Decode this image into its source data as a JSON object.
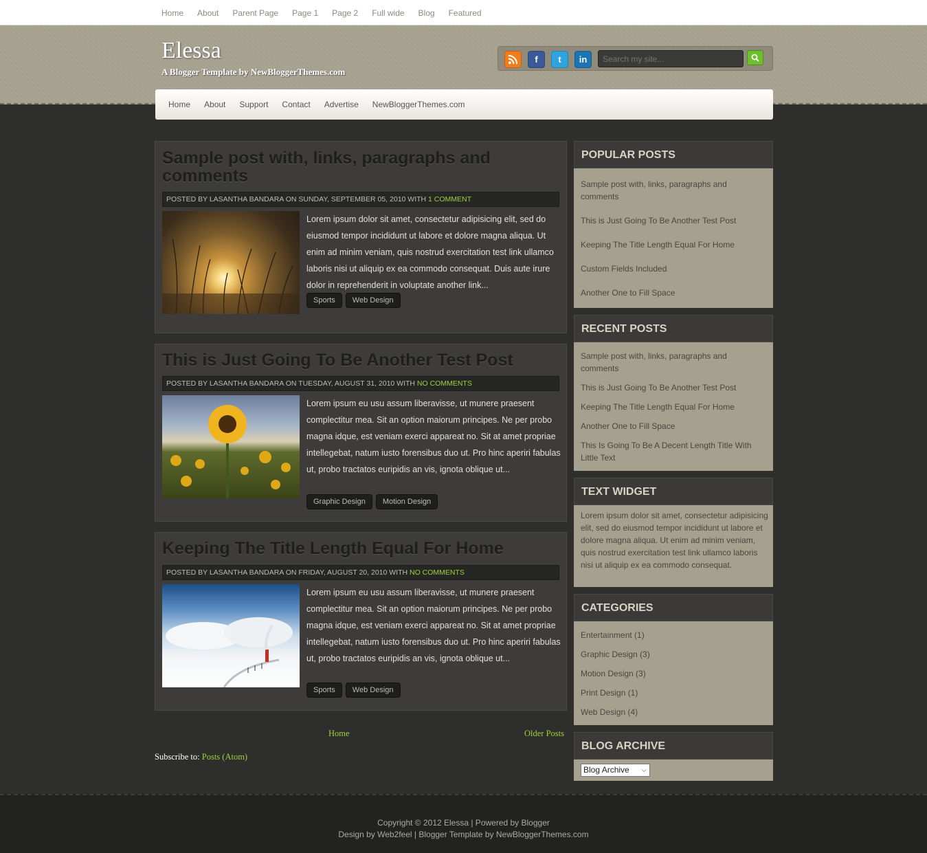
{
  "topnav": [
    "Home",
    "About",
    "Parent Page",
    "Page 1",
    "Page 2",
    "Full wide",
    "Blog",
    "Featured"
  ],
  "header": {
    "title": "Elessa",
    "description": "A Blogger Template by NewBloggerThemes.com",
    "search_placeholder": "Search my site...",
    "social_icons": [
      "rss-icon",
      "facebook-icon",
      "twitter-icon",
      "linkedin-icon"
    ]
  },
  "mainnav": [
    "Home",
    "About",
    "Support",
    "Contact",
    "Advertise",
    "NewBloggerThemes.com"
  ],
  "posts": [
    {
      "title": "Sample post with, links, paragraphs and comments",
      "meta_prefix": "Posted by Lasantha Bandara on Sunday, September 05, 2010 with",
      "comments": "1 comment",
      "excerpt": "Lorem ipsum dolor sit amet, consectetur adipisicing elit, sed do eiusmod tempor incididunt ut labore et dolore magna aliqua. Ut enim ad minim veniam, quis nostrud exercitation test link ullamco laboris nisi ut aliquip ex ea commodo consequat. Duis aute irure dolor in reprehenderit in voluptate another link...",
      "tags": [
        "Sports",
        "Web Design"
      ]
    },
    {
      "title": "This is Just Going To Be Another Test Post",
      "meta_prefix": "Posted by Lasantha Bandara on Tuesday, August 31, 2010 with",
      "comments": "No comments",
      "excerpt": "Lorem ipsum eu usu assum liberavisse, ut munere praesent complectitur mea. Sit an option maiorum principes. Ne per probo magna idque, est veniam exerci appareat no. Sit at amet propriae intellegebat, natum iusto forensibus duo ut. Pro hinc aperiri fabulas ut, probo tractatos euripidis an vis, ignota oblique ut...",
      "tags": [
        "Graphic Design",
        "Motion Design"
      ]
    },
    {
      "title": "Keeping The Title Length Equal For Home",
      "meta_prefix": "Posted by Lasantha Bandara on Friday, August 20, 2010 with",
      "comments": "No comments",
      "excerpt": "Lorem ipsum eu usu assum liberavisse, ut munere praesent complectitur mea. Sit an option maiorum principes. Ne per probo magna idque, est veniam exerci appareat no. Sit at amet propriae intellegebat, natum iusto forensibus duo ut. Pro hinc aperiri fabulas ut, probo tractatos euripidis an vis, ignota oblique ut...",
      "tags": [
        "Sports",
        "Web Design"
      ]
    }
  ],
  "pager": {
    "home": "Home",
    "older": "Older Posts"
  },
  "subscribe": {
    "label": "Subscribe to:",
    "link": "Posts (Atom)"
  },
  "sidebar": {
    "popular": {
      "title": "POPULAR POSTS",
      "items": [
        "Sample post with, links, paragraphs and comments",
        "This is Just Going To Be Another Test Post",
        "Keeping The Title Length Equal For Home",
        "Custom Fields Included",
        "Another One to Fill Space"
      ]
    },
    "recent": {
      "title": "RECENT POSTS",
      "items": [
        "Sample post with, links, paragraphs and comments",
        "This is Just Going To Be Another Test Post",
        "Keeping The Title Length Equal For Home",
        "Another One to Fill Space",
        "This Is Going To Be A Decent Length Title With Little Text"
      ]
    },
    "text_widget": {
      "title": "TEXT WIDGET",
      "text": "Lorem ipsum dolor sit amet, consectetur adipisicing elit, sed do eiusmod tempor incididunt ut labore et dolore magna aliqua. Ut enim ad minim veniam, quis nostrud exercitation test link ullamco laboris nisi ut aliquip ex ea commodo consequat."
    },
    "categories": {
      "title": "CATEGORIES",
      "items": [
        "Entertainment (1)",
        "Graphic Design (3)",
        "Motion Design (3)",
        "Print Design (1)",
        "Web Design (4)"
      ]
    },
    "archive": {
      "title": "BLOG ARCHIVE",
      "selected": "Blog Archive"
    }
  },
  "footer": {
    "line1": "Copyright © 2012 Elessa | Powered by Blogger",
    "line2": "Design by Web2feel | Blogger Template by NewBloggerThemes.com"
  },
  "colors": {
    "accent_green": "#9fd336",
    "header_tan": "#a6a18f",
    "body_dark": "#2e2e2d"
  }
}
